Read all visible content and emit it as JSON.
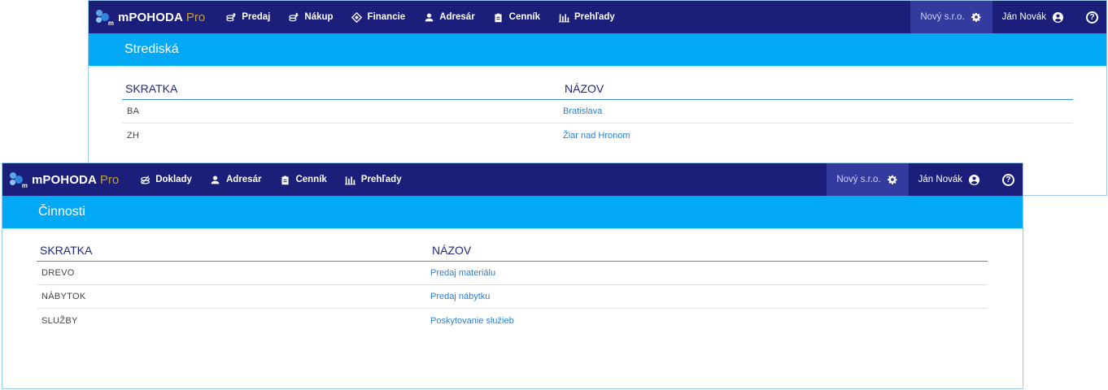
{
  "back_window": {
    "brand": {
      "name": "mPOHODA",
      "suffix": "Pro"
    },
    "nav": [
      {
        "label": "Predaj",
        "icon": "coins-up-icon"
      },
      {
        "label": "Nákup",
        "icon": "coins-down-icon"
      },
      {
        "label": "Financie",
        "icon": "finance-icon"
      },
      {
        "label": "Adresár",
        "icon": "person-icon"
      },
      {
        "label": "Cenník",
        "icon": "clipboard-icon"
      },
      {
        "label": "Prehľady",
        "icon": "bar-chart-icon"
      }
    ],
    "company": "Nový s.r.o.",
    "user": "Ján Novák",
    "help": "?",
    "title": "Strediská",
    "columns": [
      "SKRATKA",
      "NÁZOV"
    ],
    "rows": [
      {
        "code": "BA",
        "name": "Bratislava"
      },
      {
        "code": "ZH",
        "name": "Žiar nad Hronom"
      }
    ]
  },
  "front_window": {
    "brand": {
      "name": "mPOHODA",
      "suffix": "Pro"
    },
    "nav": [
      {
        "label": "Doklady",
        "icon": "coins-icon"
      },
      {
        "label": "Adresár",
        "icon": "person-icon"
      },
      {
        "label": "Cenník",
        "icon": "clipboard-icon"
      },
      {
        "label": "Prehľady",
        "icon": "bar-chart-icon"
      }
    ],
    "company": "Nový s.r.o.",
    "user": "Ján Novák",
    "help": "?",
    "title": "Činnosti",
    "columns": [
      "SKRATKA",
      "NÁZOV"
    ],
    "rows": [
      {
        "code": "DREVO",
        "name": "Predaj materiálu"
      },
      {
        "code": "NÁBYTOK",
        "name": "Predaj nábytku"
      },
      {
        "code": "SLUŽBY",
        "name": "Poskytovanie služieb"
      }
    ]
  },
  "colors": {
    "navbar": "#1b1f7a",
    "titlebar": "#03a9f4",
    "company_bg": "#333b9e",
    "link": "#2a7fd4",
    "pro": "#c8a13a"
  }
}
